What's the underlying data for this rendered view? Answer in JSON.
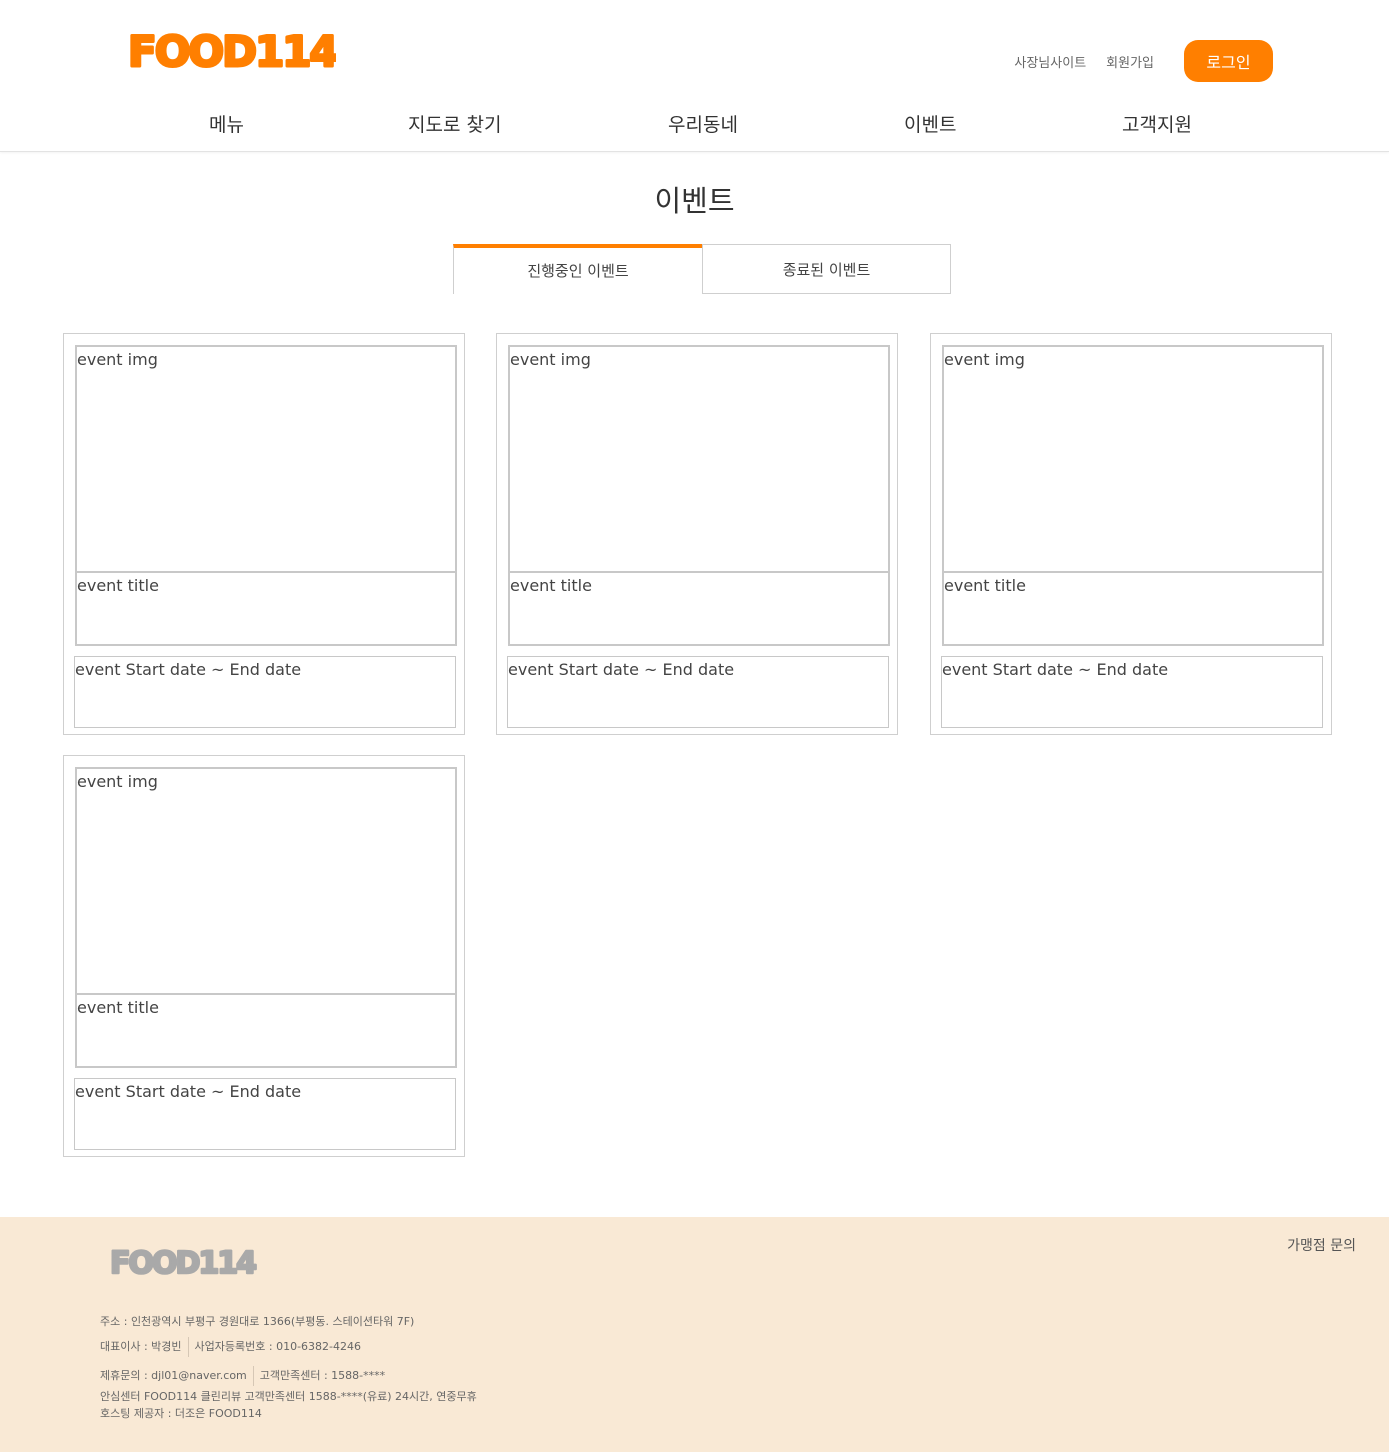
{
  "brand": {
    "logo_text": "FOOD114",
    "accent": "#ff7f00",
    "footer_bg": "#f9e9d5"
  },
  "header": {
    "links": {
      "owner_site": "사장님사이트",
      "signup": "회원가입"
    },
    "login_label": "로그인",
    "nav": [
      "메뉴",
      "지도로 찾기",
      "우리동네",
      "이벤트",
      "고객지원"
    ]
  },
  "page": {
    "title": "이벤트",
    "tabs": {
      "ongoing": "진행중인 이벤트",
      "ended": "종료된 이벤트"
    },
    "active_tab": "ongoing"
  },
  "events": [
    {
      "img": "event img",
      "title": "event title",
      "date": "event Start date ~ End date"
    },
    {
      "img": "event img",
      "title": "event title",
      "date": "event Start date ~ End date"
    },
    {
      "img": "event img",
      "title": "event title",
      "date": "event Start date ~ End date"
    },
    {
      "img": "event img",
      "title": "event title",
      "date": "event Start date ~ End date"
    }
  ],
  "footer": {
    "franchise_inquiry": "가맹점 문의",
    "address": "주소 : 인천광역시 부평구 경원대로 1366(부평동. 스테이션타워 7F)",
    "ceo": "대표이사 : 박경빈",
    "business_no": "사업자등록번호 : 010-6382-4246",
    "partnership": "제휴문의 : djl01@naver.com",
    "cs_center": "고객만족센터 : 1588-****",
    "safety_center": "안심센터 FOOD114 클린리뷰 고객만족센터 1588-****(유료) 24시간, 연중무휴",
    "hosting": "호스팅 제공자 : 더조은 FOOD114"
  }
}
